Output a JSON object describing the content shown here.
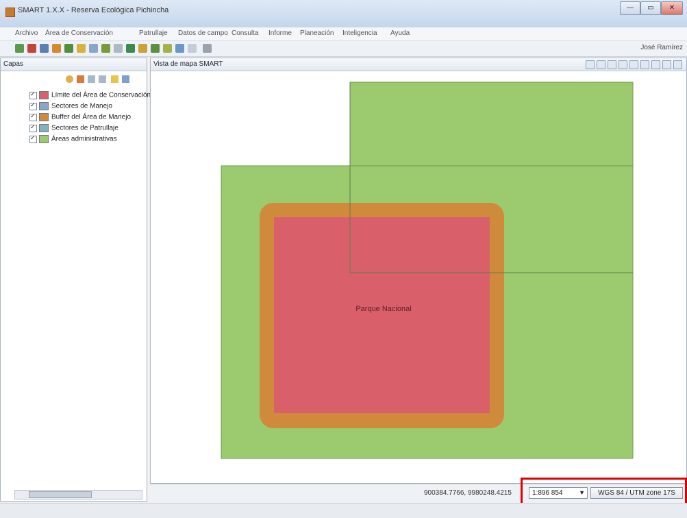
{
  "window": {
    "title": "SMART 1.X.X - Reserva Ecológica Pichincha",
    "buttons": [
      "—",
      "▭",
      "✕"
    ]
  },
  "menu": [
    "Archivo",
    "Área de Conservación",
    "Patrullaje",
    "Datos de campo",
    "Consulta",
    "Informe",
    "Planeación",
    "Inteligencia",
    "Ayuda"
  ],
  "toolbar": {
    "user": "José Ramírez"
  },
  "left_panel": {
    "tab_label": "Capas",
    "layers": [
      "Límite del Área de Conservación",
      "Sectores de Manejo",
      "Buffer del Área de Manejo",
      "Sectores de Patrullaje",
      "Áreas administrativas"
    ]
  },
  "map_panel": {
    "tab_label": "Vista de mapa SMART",
    "feature_label": "Parque Nacional"
  },
  "status": {
    "coords": "900384.7766, 9980248.4215",
    "scale": "1:896 854",
    "crs": "WGS 84 / UTM zone 17S"
  },
  "colors": {
    "green_fill": "#9ccb6f",
    "orange_buffer": "#d08a3b",
    "red_park": "#d9606b",
    "highlight": "#e00000"
  }
}
